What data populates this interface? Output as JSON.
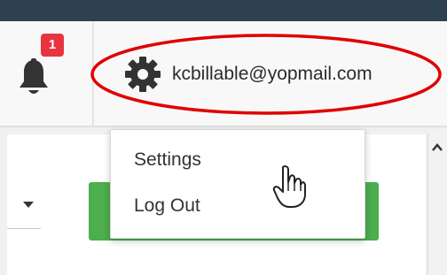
{
  "notifications": {
    "count": "1",
    "icon": "bell-icon"
  },
  "user_menu": {
    "email": "kcbillable@yopmail.com",
    "icon": "gear-icon"
  },
  "dropdown": {
    "items": [
      {
        "label": "Settings"
      },
      {
        "label": "Log Out"
      }
    ]
  },
  "colors": {
    "topbar": "#2e4150",
    "badge": "#e8343f",
    "highlight": "#e00000",
    "primary_button": "#4cae4c",
    "icon": "#333333"
  }
}
